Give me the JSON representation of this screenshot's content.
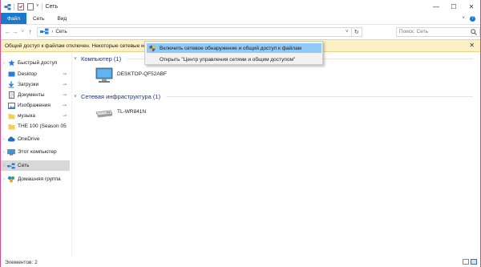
{
  "window": {
    "title": "Сеть",
    "controls": {
      "minimize": "—",
      "maximize": "☐",
      "close": "✕"
    }
  },
  "ribbon": {
    "tabs": [
      "Файл",
      "Сеть",
      "Вид"
    ],
    "collapse": "˅",
    "help": "?"
  },
  "nav": {
    "back": "←",
    "forward": "→",
    "recent": "˅",
    "up": "↑",
    "breadcrumb_sep": "›",
    "location": "Сеть",
    "dropdown": "˅",
    "refresh": "↻",
    "search_placeholder": "Поиск: Сеть"
  },
  "infobar": {
    "text": "Общий доступ к файлам отключен. Некоторые сетевые ко",
    "close": "✕"
  },
  "context_menu": {
    "items": [
      {
        "label": "Включить сетевое обнаружение и общий доступ к файлам",
        "highlighted": true,
        "icon": "shield-icon"
      },
      {
        "label": "Открыть \"Центр управления сетями и общим доступом\"",
        "highlighted": false,
        "icon": ""
      }
    ]
  },
  "sidebar": {
    "items": [
      {
        "label": "Быстрый доступ",
        "icon": "star-icon",
        "pinned": false,
        "selected": false
      },
      {
        "label": "Desktop",
        "icon": "desktop-icon",
        "pinned": true,
        "selected": false
      },
      {
        "label": "Загрузки",
        "icon": "download-icon",
        "pinned": true,
        "selected": false
      },
      {
        "label": "Документы",
        "icon": "documents-icon",
        "pinned": true,
        "selected": false
      },
      {
        "label": "Изображения",
        "icon": "pictures-icon",
        "pinned": true,
        "selected": false
      },
      {
        "label": "музыка",
        "icon": "folder-icon",
        "pinned": true,
        "selected": false
      },
      {
        "label": "THE 100 (Season 05",
        "icon": "folder-icon",
        "pinned": false,
        "selected": false
      },
      {
        "label": "OneDrive",
        "icon": "cloud-icon",
        "pinned": false,
        "selected": false
      },
      {
        "label": "Этот компьютер",
        "icon": "computer-icon",
        "pinned": false,
        "selected": false
      },
      {
        "label": "Сеть",
        "icon": "network-icon",
        "pinned": false,
        "selected": true
      },
      {
        "label": "Домашняя группа",
        "icon": "homegroup-icon",
        "pinned": false,
        "selected": false
      }
    ],
    "pin_glyph": "📌",
    "expand_glyph": "›"
  },
  "content": {
    "groups": [
      {
        "header": "Компьютер (1)",
        "items": [
          {
            "name": "DESKTOP-QF52ABF",
            "icon": "monitor-icon"
          }
        ]
      },
      {
        "header": "Сетевая инфраструктура (1)",
        "items": [
          {
            "name": "TL-WR841N",
            "icon": "router-icon"
          }
        ]
      }
    ],
    "collapse_glyph": "˅"
  },
  "status": {
    "text": "Элементов: 2"
  },
  "colors": {
    "accent": "#1979ca",
    "window_border": "#d94a8c",
    "infobar_bg": "#fcf1c5",
    "menu_highlight": "#91c9f7",
    "group_header": "#1e3287",
    "sidebar_selected": "#d8d8d8"
  }
}
